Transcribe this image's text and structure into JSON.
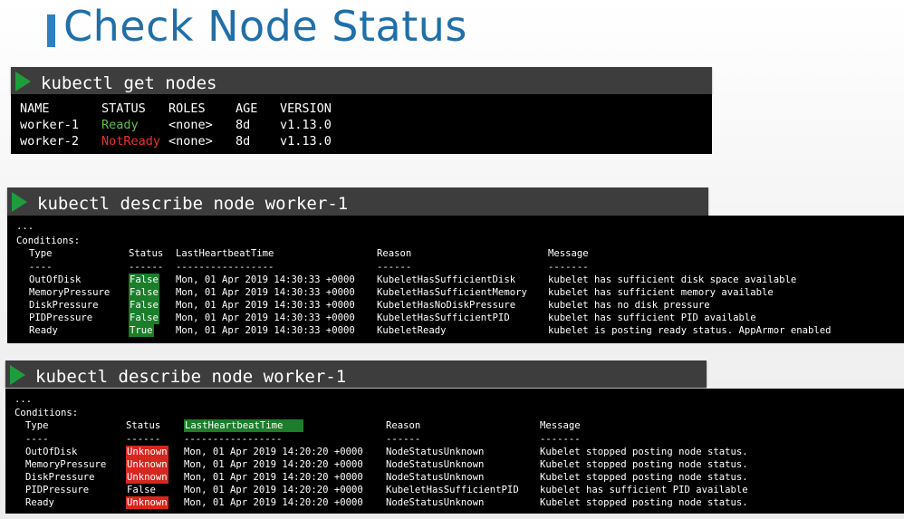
{
  "title": "Check Node Status",
  "colors": {
    "title": "#1f6fa8",
    "accent_bar": "#2a82c4",
    "ready": "#5fbf4a",
    "not_ready": "#e8352d",
    "true_false_bg": "#1c7d2a",
    "unknown_bg": "#d6261f"
  },
  "block1": {
    "command": "kubectl get nodes",
    "headers": [
      "NAME",
      "STATUS",
      "ROLES",
      "AGE",
      "VERSION"
    ],
    "rows": [
      {
        "name": "worker-1",
        "status": "Ready",
        "roles": "<none>",
        "age": "8d",
        "version": "v1.13.0"
      },
      {
        "name": "worker-2",
        "status": "NotReady",
        "roles": "<none>",
        "age": "8d",
        "version": "v1.13.0"
      }
    ]
  },
  "block2": {
    "command": "kubectl describe node worker-1",
    "ellipsis": "...",
    "conditions_label": "Conditions:",
    "headers": [
      "Type",
      "Status",
      "LastHeartbeatTime",
      "Reason",
      "Message"
    ],
    "dashes": [
      "----",
      "------",
      "-----------------",
      "------",
      "-------"
    ],
    "rows": [
      {
        "type": "OutOfDisk",
        "status": "False",
        "time": "Mon, 01 Apr 2019 14:30:33 +0000",
        "reason": "KubeletHasSufficientDisk",
        "message": "kubelet has sufficient disk space available"
      },
      {
        "type": "MemoryPressure",
        "status": "False",
        "time": "Mon, 01 Apr 2019 14:30:33 +0000",
        "reason": "KubeletHasSufficientMemory",
        "message": "kubelet has sufficient memory available"
      },
      {
        "type": "DiskPressure",
        "status": "False",
        "time": "Mon, 01 Apr 2019 14:30:33 +0000",
        "reason": "KubeletHasNoDiskPressure",
        "message": "kubelet has no disk pressure"
      },
      {
        "type": "PIDPressure",
        "status": "False",
        "time": "Mon, 01 Apr 2019 14:30:33 +0000",
        "reason": "KubeletHasSufficientPID",
        "message": "kubelet has sufficient PID available"
      },
      {
        "type": "Ready",
        "status": "True",
        "time": "Mon, 01 Apr 2019 14:30:33 +0000",
        "reason": "KubeletReady",
        "message": "kubelet is posting ready status. AppArmor enabled"
      }
    ]
  },
  "block3": {
    "command": "kubectl describe node worker-1",
    "ellipsis": "...",
    "conditions_label": "Conditions:",
    "headers": [
      "Type",
      "Status",
      "LastHeartbeatTime",
      "Reason",
      "Message"
    ],
    "dashes": [
      "----",
      "------",
      "-----------------",
      "------",
      "-------"
    ],
    "rows": [
      {
        "type": "OutOfDisk",
        "status": "Unknown",
        "time": "Mon, 01 Apr 2019 14:20:20 +0000",
        "reason": "NodeStatusUnknown",
        "message": "Kubelet stopped posting node status."
      },
      {
        "type": "MemoryPressure",
        "status": "Unknown",
        "time": "Mon, 01 Apr 2019 14:20:20 +0000",
        "reason": "NodeStatusUnknown",
        "message": "Kubelet stopped posting node status."
      },
      {
        "type": "DiskPressure",
        "status": "Unknown",
        "time": "Mon, 01 Apr 2019 14:20:20 +0000",
        "reason": "NodeStatusUnknown",
        "message": "Kubelet stopped posting node status."
      },
      {
        "type": "PIDPressure",
        "status": "False",
        "time": "Mon, 01 Apr 2019 14:20:20 +0000",
        "reason": "KubeletHasSufficientPID",
        "message": "kubelet has sufficient PID available"
      },
      {
        "type": "Ready",
        "status": "Unknown",
        "time": "Mon, 01 Apr 2019 14:20:20 +0000",
        "reason": "NodeStatusUnknown",
        "message": "Kubelet stopped posting node status."
      }
    ]
  }
}
